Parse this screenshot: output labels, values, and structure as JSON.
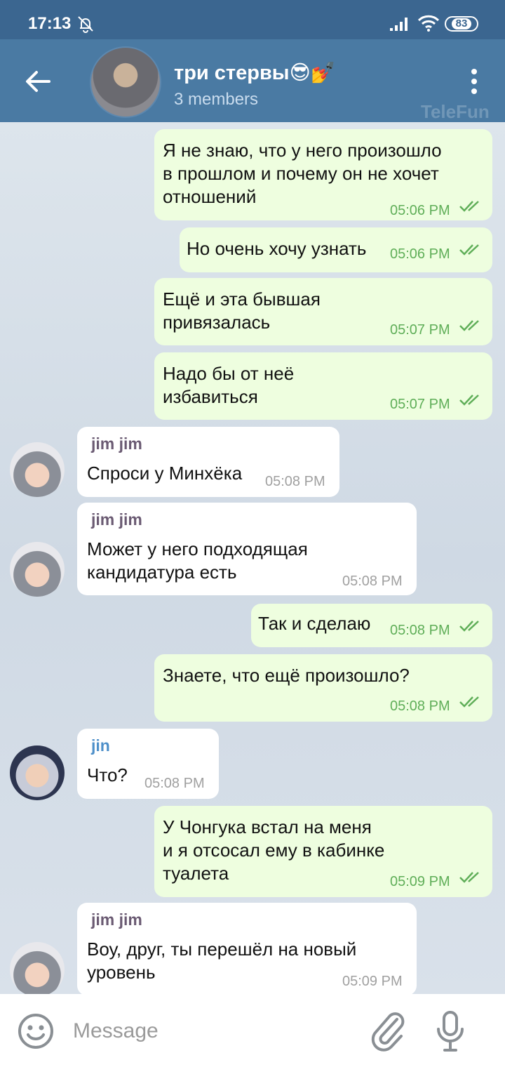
{
  "status_bar": {
    "time": "17:13",
    "battery": "83"
  },
  "header": {
    "title": "три стервы😎💅",
    "subtitle": "3 members",
    "watermark": "TeleFun"
  },
  "messages": [
    {
      "dir": "out",
      "text": "Я не знаю, что у него произошло\nв прошлом и почему он не хочет\nотношений",
      "time": "05:06 PM"
    },
    {
      "dir": "out",
      "text": "Но очень хочу узнать",
      "time": "05:06 PM"
    },
    {
      "dir": "out",
      "text": "Ещё и эта бывшая\nпривязалась",
      "time": "05:07 PM"
    },
    {
      "dir": "out",
      "text": "Надо бы от неё\nизбавиться",
      "time": "05:07 PM"
    },
    {
      "dir": "in",
      "sender": "jim jim",
      "text": "Спроси у Минхёка",
      "time": "05:08 PM"
    },
    {
      "dir": "in",
      "sender": "jim jim",
      "text": "Может у него подходящая\nкандидатура есть",
      "time": "05:08 PM"
    },
    {
      "dir": "out",
      "text": "Так и сделаю",
      "time": "05:08 PM"
    },
    {
      "dir": "out",
      "text": "Знаете, что ещё произошло?",
      "time": "05:08 PM"
    },
    {
      "dir": "in",
      "sender": "jin",
      "text": "Что?",
      "time": "05:08 PM"
    },
    {
      "dir": "out",
      "text": "У Чонгука встал на меня\nи я отсосал ему в кабинке\nтуалета",
      "time": "05:09 PM"
    },
    {
      "dir": "in",
      "sender": "jim jim",
      "text": "Воу, друг, ты перешёл на новый\nуровень",
      "time": "05:09 PM"
    }
  ],
  "input": {
    "placeholder": "Message"
  },
  "icons": {
    "back": "arrow-left-icon",
    "menu": "dots-vertical-icon",
    "emoji": "smiley-icon",
    "attach": "paperclip-icon",
    "mic": "microphone-icon",
    "read": "double-check-icon"
  },
  "colors": {
    "header": "#4a7aa3",
    "status_bar": "#3b6690",
    "outgoing_bubble": "#eefedf",
    "incoming_bubble": "#ffffff",
    "read_check": "#5fae58",
    "sender_jimjim": "#6a5a72",
    "sender_jin": "#4d8fc9"
  }
}
